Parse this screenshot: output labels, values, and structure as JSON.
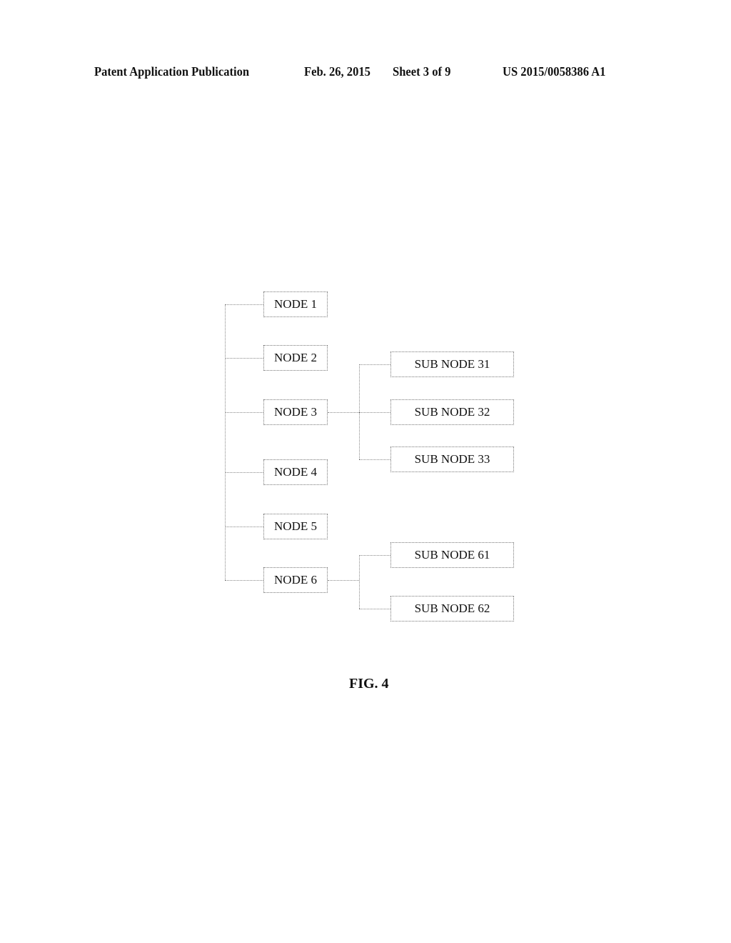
{
  "header": {
    "left": "Patent Application Publication",
    "date": "Feb. 26, 2015",
    "sheet": "Sheet 3 of 9",
    "number": "US 2015/0058386 A1"
  },
  "nodes": [
    {
      "label": "NODE 1"
    },
    {
      "label": "NODE 2"
    },
    {
      "label": "NODE 3"
    },
    {
      "label": "NODE 4"
    },
    {
      "label": "NODE 5"
    },
    {
      "label": "NODE 6"
    }
  ],
  "sub_nodes": {
    "node3": [
      {
        "label": "SUB NODE 31"
      },
      {
        "label": "SUB NODE 32"
      },
      {
        "label": "SUB NODE 33"
      }
    ],
    "node6": [
      {
        "label": "SUB NODE 61"
      },
      {
        "label": "SUB NODE 62"
      }
    ]
  },
  "figure_label": "FIG. 4"
}
